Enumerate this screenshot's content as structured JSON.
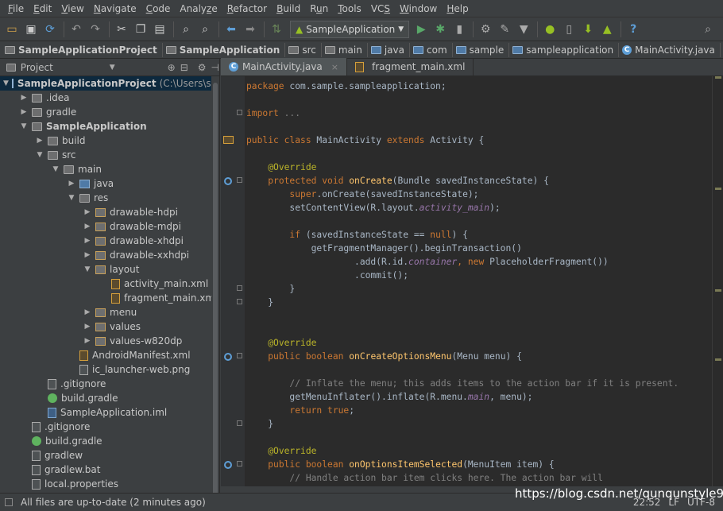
{
  "menubar": {
    "items": [
      {
        "pre": "",
        "ul": "F",
        "post": "ile"
      },
      {
        "pre": "",
        "ul": "E",
        "post": "dit"
      },
      {
        "pre": "",
        "ul": "V",
        "post": "iew"
      },
      {
        "pre": "",
        "ul": "N",
        "post": "avigate"
      },
      {
        "pre": "",
        "ul": "C",
        "post": "ode"
      },
      {
        "pre": "Analy",
        "ul": "z",
        "post": "e"
      },
      {
        "pre": "",
        "ul": "R",
        "post": "efactor"
      },
      {
        "pre": "",
        "ul": "B",
        "post": "uild"
      },
      {
        "pre": "R",
        "ul": "u",
        "post": "n"
      },
      {
        "pre": "",
        "ul": "T",
        "post": "ools"
      },
      {
        "pre": "VC",
        "ul": "S",
        "post": ""
      },
      {
        "pre": "",
        "ul": "W",
        "post": "indow"
      },
      {
        "pre": "",
        "ul": "H",
        "post": "elp"
      }
    ]
  },
  "toolbar": {
    "run_config": "SampleApplication",
    "help_glyph": "?"
  },
  "breadcrumb": [
    "SampleApplicationProject",
    "SampleApplication",
    "src",
    "main",
    "java",
    "com",
    "sample",
    "sampleapplication",
    "MainActivity.java"
  ],
  "project": {
    "header": "Project",
    "tree": [
      {
        "label": "SampleApplicationProject",
        "extra": "(C:\\Users\\sams",
        "depth": 0,
        "arrow": "▼",
        "icon": "proj",
        "bold": true,
        "selected": true
      },
      {
        "label": ".idea",
        "depth": 1,
        "arrow": "▶",
        "icon": "fold"
      },
      {
        "label": "gradle",
        "depth": 1,
        "arrow": "▶",
        "icon": "fold"
      },
      {
        "label": "SampleApplication",
        "depth": 1,
        "arrow": "▼",
        "icon": "fold",
        "bold": true
      },
      {
        "label": "build",
        "depth": 2,
        "arrow": "▶",
        "icon": "fold"
      },
      {
        "label": "src",
        "depth": 2,
        "arrow": "▼",
        "icon": "fold"
      },
      {
        "label": "main",
        "depth": 3,
        "arrow": "▼",
        "icon": "fold"
      },
      {
        "label": "java",
        "depth": 4,
        "arrow": "▶",
        "icon": "srcf"
      },
      {
        "label": "res",
        "depth": 4,
        "arrow": "▼",
        "icon": "fold"
      },
      {
        "label": "drawable-hdpi",
        "depth": 5,
        "arrow": "▶",
        "icon": "resf"
      },
      {
        "label": "drawable-mdpi",
        "depth": 5,
        "arrow": "▶",
        "icon": "resf"
      },
      {
        "label": "drawable-xhdpi",
        "depth": 5,
        "arrow": "▶",
        "icon": "resf"
      },
      {
        "label": "drawable-xxhdpi",
        "depth": 5,
        "arrow": "▶",
        "icon": "resf"
      },
      {
        "label": "layout",
        "depth": 5,
        "arrow": "▼",
        "icon": "resf"
      },
      {
        "label": "activity_main.xml",
        "depth": 6,
        "arrow": "",
        "icon": "xml"
      },
      {
        "label": "fragment_main.xml",
        "depth": 6,
        "arrow": "",
        "icon": "xml"
      },
      {
        "label": "menu",
        "depth": 5,
        "arrow": "▶",
        "icon": "resf"
      },
      {
        "label": "values",
        "depth": 5,
        "arrow": "▶",
        "icon": "resf"
      },
      {
        "label": "values-w820dp",
        "depth": 5,
        "arrow": "▶",
        "icon": "resf"
      },
      {
        "label": "AndroidManifest.xml",
        "depth": 4,
        "arrow": "",
        "icon": "xml"
      },
      {
        "label": "ic_launcher-web.png",
        "depth": 4,
        "arrow": "",
        "icon": "file"
      },
      {
        "label": ".gitignore",
        "depth": 2,
        "arrow": "",
        "icon": "file"
      },
      {
        "label": "build.gradle",
        "depth": 2,
        "arrow": "",
        "icon": "grad"
      },
      {
        "label": "SampleApplication.iml",
        "depth": 2,
        "arrow": "",
        "icon": "iml"
      },
      {
        "label": ".gitignore",
        "depth": 1,
        "arrow": "",
        "icon": "file"
      },
      {
        "label": "build.gradle",
        "depth": 1,
        "arrow": "",
        "icon": "grad"
      },
      {
        "label": "gradlew",
        "depth": 1,
        "arrow": "",
        "icon": "file"
      },
      {
        "label": "gradlew.bat",
        "depth": 1,
        "arrow": "",
        "icon": "file"
      },
      {
        "label": "local.properties",
        "depth": 1,
        "arrow": "",
        "icon": "file"
      }
    ]
  },
  "editor": {
    "tabs": [
      {
        "label": "MainActivity.java",
        "icon": "C",
        "active": true,
        "close": "×"
      },
      {
        "label": "fragment_main.xml",
        "icon": "xml",
        "active": false,
        "close": ""
      }
    ],
    "lines": [
      {
        "t": [
          [
            "kw",
            "package "
          ],
          [
            "",
            "com.sample.sampleapplication;"
          ]
        ]
      },
      {
        "t": []
      },
      {
        "t": [
          [
            "kw",
            "import "
          ],
          [
            "cm",
            "..."
          ]
        ]
      },
      {
        "t": []
      },
      {
        "t": [
          [
            "kw",
            "public class "
          ],
          [
            "",
            "MainActivity "
          ],
          [
            "kw",
            "extends "
          ],
          [
            "",
            "Activity {"
          ]
        ]
      },
      {
        "t": []
      },
      {
        "t": [
          [
            "",
            "    "
          ],
          [
            "ann",
            "@Override"
          ]
        ]
      },
      {
        "t": [
          [
            "",
            "    "
          ],
          [
            "kw",
            "protected void "
          ],
          [
            "fn",
            "onCreate"
          ],
          [
            "",
            "(Bundle savedInstanceState) {"
          ]
        ]
      },
      {
        "t": [
          [
            "",
            "        "
          ],
          [
            "kw",
            "super"
          ],
          [
            "",
            ".onCreate(savedInstanceState);"
          ]
        ]
      },
      {
        "t": [
          [
            "",
            "        setContentView(R.layout."
          ],
          [
            "it",
            "activity_main"
          ],
          [
            "",
            ");"
          ]
        ]
      },
      {
        "t": []
      },
      {
        "t": [
          [
            "",
            "        "
          ],
          [
            "kw",
            "if "
          ],
          [
            "",
            "(savedInstanceState == "
          ],
          [
            "kw",
            "null"
          ],
          [
            "",
            ") {"
          ]
        ]
      },
      {
        "t": [
          [
            "",
            "            getFragmentManager().beginTransaction()"
          ]
        ]
      },
      {
        "t": [
          [
            "",
            "                    .add(R.id."
          ],
          [
            "it",
            "container"
          ],
          [
            "kw",
            ", new "
          ],
          [
            "",
            "PlaceholderFragment())"
          ]
        ]
      },
      {
        "t": [
          [
            "",
            "                    .commit();"
          ]
        ]
      },
      {
        "t": [
          [
            "",
            "        }"
          ]
        ]
      },
      {
        "t": [
          [
            "",
            "    }"
          ]
        ]
      },
      {
        "t": []
      },
      {
        "t": []
      },
      {
        "t": [
          [
            "",
            "    "
          ],
          [
            "ann",
            "@Override"
          ]
        ]
      },
      {
        "t": [
          [
            "",
            "    "
          ],
          [
            "kw",
            "public boolean "
          ],
          [
            "fn",
            "onCreateOptionsMenu"
          ],
          [
            "",
            "(Menu menu) {"
          ]
        ]
      },
      {
        "t": []
      },
      {
        "t": [
          [
            "",
            "        "
          ],
          [
            "cm",
            "// Inflate the menu; this adds items to the action bar if it is present."
          ]
        ]
      },
      {
        "t": [
          [
            "",
            "        getMenuInflater().inflate(R.menu."
          ],
          [
            "it",
            "main"
          ],
          [
            "",
            ", menu);"
          ]
        ]
      },
      {
        "t": [
          [
            "",
            "        "
          ],
          [
            "kw",
            "return true"
          ],
          [
            "",
            ";"
          ]
        ]
      },
      {
        "t": [
          [
            "",
            "    }"
          ]
        ]
      },
      {
        "t": []
      },
      {
        "t": [
          [
            "",
            "    "
          ],
          [
            "ann",
            "@Override"
          ]
        ]
      },
      {
        "t": [
          [
            "",
            "    "
          ],
          [
            "kw",
            "public boolean "
          ],
          [
            "fn",
            "onOptionsItemSelected"
          ],
          [
            "",
            "(MenuItem item) {"
          ]
        ]
      },
      {
        "t": [
          [
            "",
            "        "
          ],
          [
            "cm",
            "// Handle action bar item clicks here. The action bar will"
          ]
        ]
      }
    ]
  },
  "status": {
    "message": "All files are up-to-date (2 minutes ago)",
    "time": "22:52",
    "line_sep": "LF",
    "encoding": "UTF-8"
  },
  "watermark": "https://blog.csdn.net/qunqunstyle99"
}
